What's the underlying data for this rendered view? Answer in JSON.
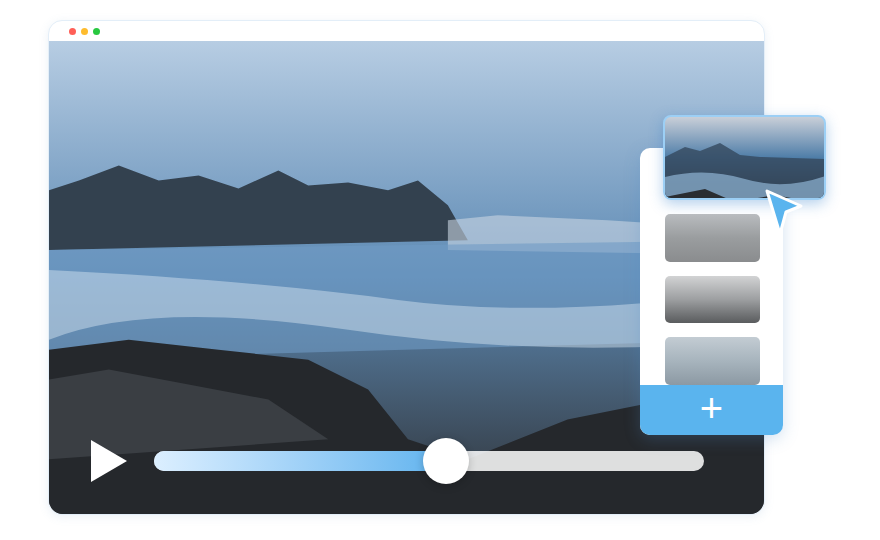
{
  "window": {
    "dots": [
      {
        "color": "#ff5f57"
      },
      {
        "color": "#febc2e"
      },
      {
        "color": "#28c840"
      }
    ]
  },
  "player": {
    "playing": false,
    "level": 0.53
  },
  "playlist": {
    "items": [
      {
        "selected": true
      },
      {
        "selected": false
      },
      {
        "selected": false
      },
      {
        "selected": false
      }
    ],
    "add_button": "+"
  }
}
